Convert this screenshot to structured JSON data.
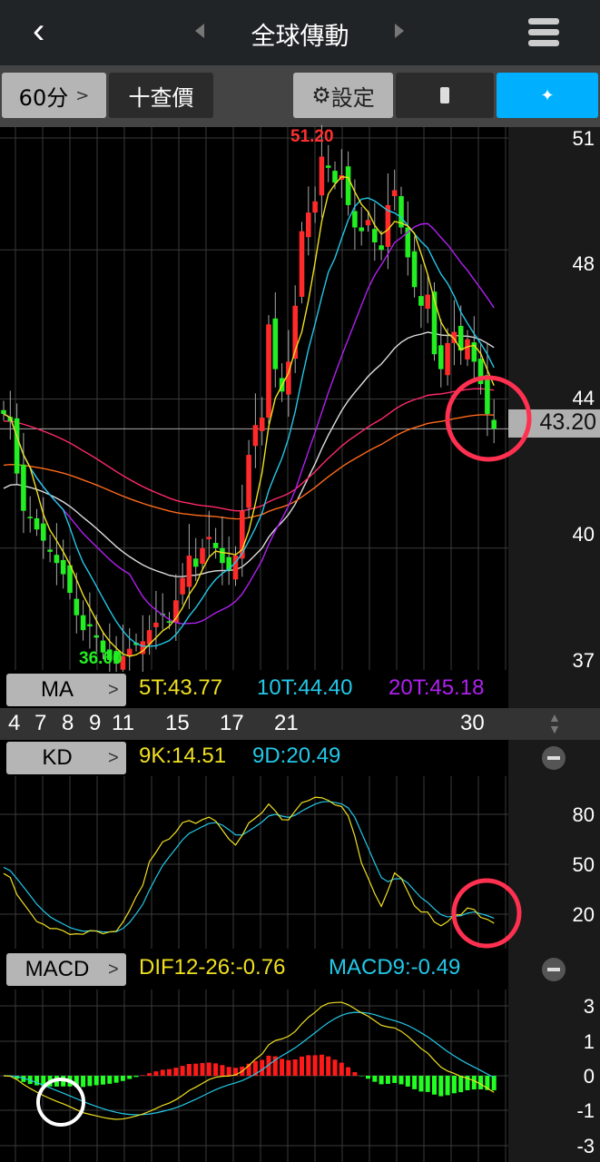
{
  "header": {
    "title": "全球傳動",
    "back_icon": "chevron-left-icon",
    "menu_icon": "hamburger-icon"
  },
  "toolbar": {
    "period": "60分",
    "period_chevron": ">",
    "quote": "十查價",
    "settings": "設定"
  },
  "colors": {
    "up": "#ff2a2a",
    "down": "#22ee22",
    "ma5": "#f0e020",
    "ma10": "#22c8e8",
    "ma20": "#b020f0",
    "accent": "#00b0ff"
  },
  "main": {
    "high_label": "51.20",
    "low_label": "36.60",
    "current_price": "43.20",
    "axis": [
      "51",
      "48",
      "44",
      "40",
      "37"
    ]
  },
  "ma_row": {
    "label": "MA",
    "values": [
      "5T:43.77",
      "10T:44.40",
      "20T:45.18"
    ]
  },
  "dates": [
    "4",
    "7",
    "8",
    "9",
    "11",
    "15",
    "17",
    "21",
    "30"
  ],
  "kd_row": {
    "label": "KD",
    "values": [
      "9K:14.51",
      "9D:20.49"
    ],
    "axis": [
      "80",
      "50",
      "20"
    ]
  },
  "macd_row": {
    "label": "MACD",
    "values": [
      "DIF12-26:-0.76",
      "MACD9:-0.49"
    ],
    "axis": [
      "3",
      "1",
      "0",
      "-1",
      "-3"
    ]
  },
  "chart_data": {
    "type": "candlestick",
    "title": "全球傳動 60分",
    "ylim": [
      37,
      51
    ],
    "close": [
      43.6,
      43.4,
      42.0,
      41.0,
      40.8,
      40.5,
      40.2,
      39.9,
      39.6,
      39.3,
      38.8,
      38.2,
      37.8,
      37.9,
      37.6,
      37.2,
      37.0,
      36.9,
      37.1,
      37.3,
      37.4,
      37.5,
      37.8,
      38.0,
      38.2,
      38.0,
      38.6,
      39.2,
      39.8,
      39.5,
      40.0,
      40.3,
      40.0,
      39.6,
      39.4,
      39.8,
      41.0,
      42.5,
      43.3,
      43.5,
      46.0,
      44.8,
      44.2,
      45.0,
      46.5,
      48.5,
      49.0,
      49.3,
      50.5,
      50.2,
      49.8,
      50.0,
      49.2,
      48.6,
      48.5,
      48.8,
      48.2,
      48.0,
      49.2,
      49.6,
      48.6,
      47.8,
      47.0,
      46.5,
      46.8,
      45.2,
      44.8,
      45.5,
      45.8,
      45.3,
      45.6,
      45.0,
      44.4,
      43.6,
      43.2
    ],
    "long_ma_start": {
      "white": 41.5,
      "orange": 42.2,
      "pink": 43.4
    }
  }
}
